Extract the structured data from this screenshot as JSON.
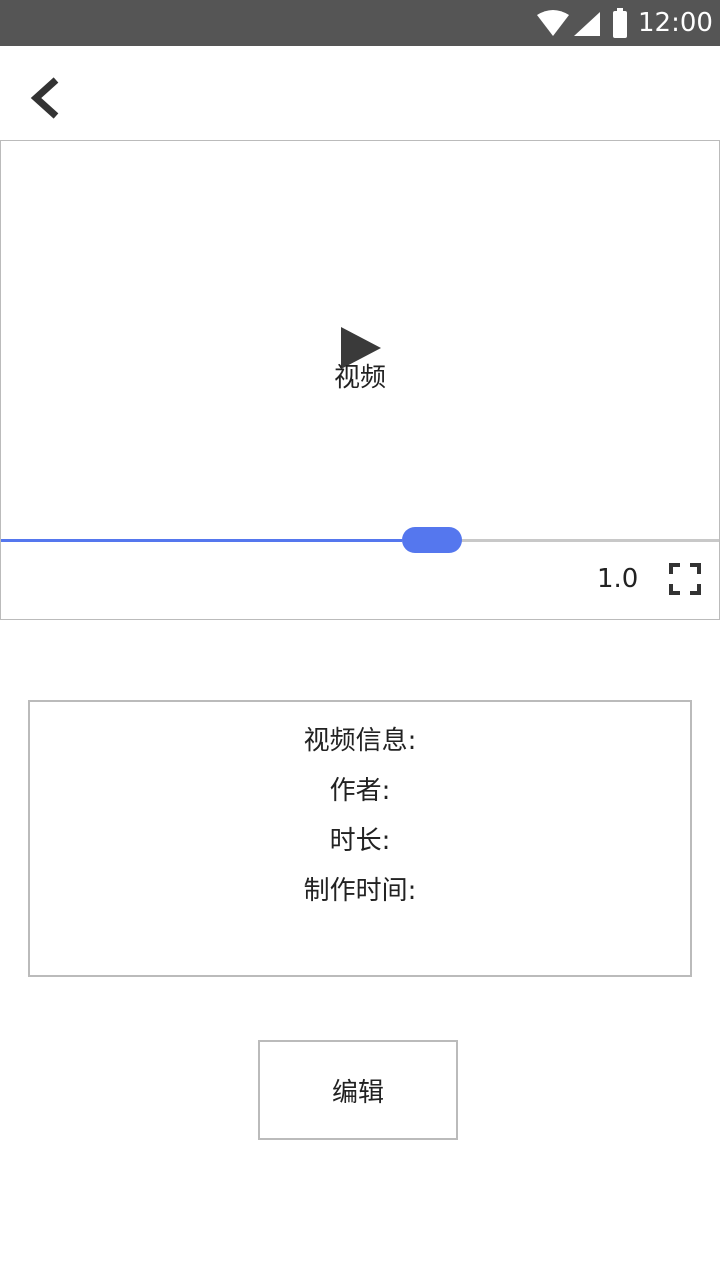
{
  "status_bar": {
    "time": "12:00",
    "icons": [
      "wifi-icon",
      "signal-icon",
      "battery-icon"
    ]
  },
  "nav": {
    "back_icon": "chevron-left-icon"
  },
  "player": {
    "play_icon": "play-icon",
    "video_label": "视频",
    "progress_fraction": 0.6,
    "playback_speed": "1.0",
    "fullscreen_icon": "fullscreen-icon",
    "accent_color": "#5577ee"
  },
  "info": {
    "title": "视频信息:",
    "author_label": "作者:",
    "duration_label": "时长:",
    "created_label": "制作时间:"
  },
  "actions": {
    "edit_label": "编辑"
  }
}
